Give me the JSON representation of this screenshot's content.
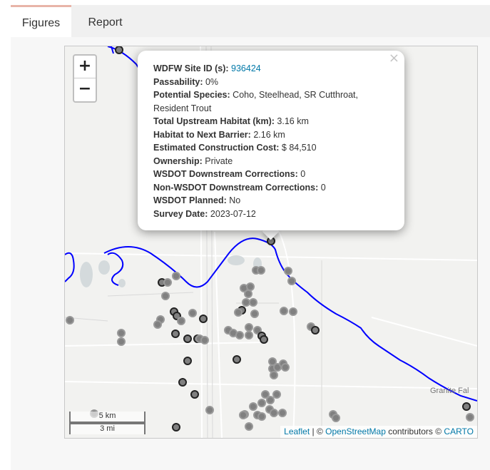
{
  "tabs": [
    {
      "label": "Figures",
      "active": true
    },
    {
      "label": "Report",
      "active": false
    }
  ],
  "map": {
    "zoom_in_label": "+",
    "zoom_out_label": "−",
    "scale_km": "5 km",
    "scale_mi": "3 mi",
    "place_label": "Granite Fal",
    "attribution": {
      "leaflet": "Leaflet",
      "separator": " | © ",
      "osm": "OpenStreetMap",
      "contributors": " contributors © ",
      "carto": "CARTO"
    },
    "river_color": "#0000ff",
    "marker_fill": "#808080",
    "marker_stroke_dark": "#222222"
  },
  "popup": {
    "close_label": "×",
    "site_id_label": "WDFW Site ID (s):",
    "site_id_value": "936424",
    "rows": [
      {
        "label": "Passability:",
        "value": "0%"
      },
      {
        "label": "Potential Species:",
        "value": "Coho, Steelhead, SR Cutthroat, Resident Trout"
      },
      {
        "label": "Total Upstream Habitat (km):",
        "value": "3.16 km"
      },
      {
        "label": "Habitat to Next Barrier:",
        "value": "2.16 km"
      },
      {
        "label": "Estimated Construction Cost:",
        "value": "$ 84,510"
      },
      {
        "label": "Ownership:",
        "value": "Private"
      },
      {
        "label": "WSDOT Downstream Corrections:",
        "value": "0"
      },
      {
        "label": "Non-WSDOT Downstream Corrections:",
        "value": "0"
      },
      {
        "label": "WSDOT Planned:",
        "value": "No"
      },
      {
        "label": "Survey Date:",
        "value": "2023-07-12"
      }
    ]
  }
}
